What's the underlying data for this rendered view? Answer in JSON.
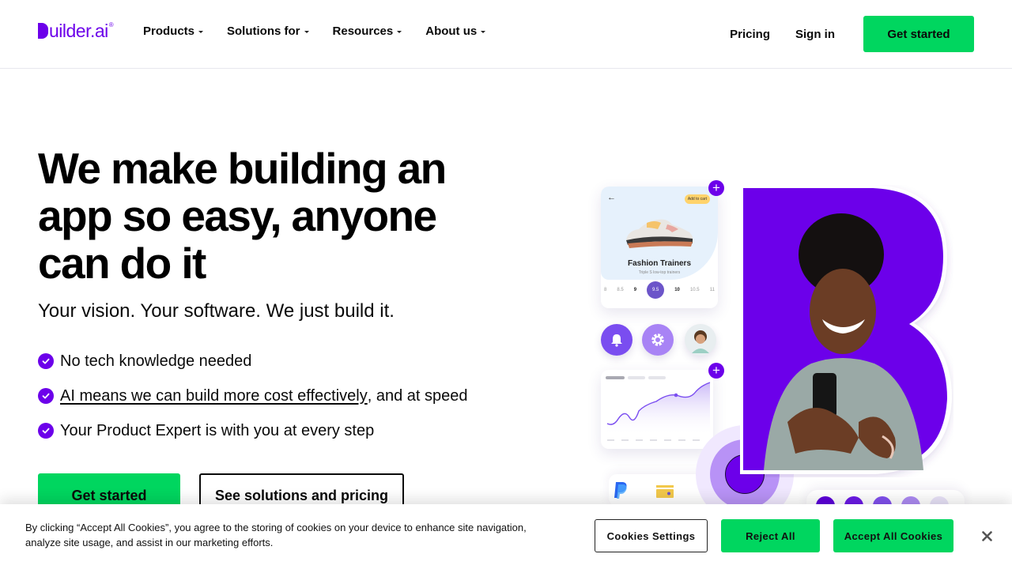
{
  "header": {
    "logo_text": "uilder.ai",
    "logo_reg": "®",
    "nav": [
      {
        "label": "Products"
      },
      {
        "label": "Solutions for"
      },
      {
        "label": "Resources"
      },
      {
        "label": "About us"
      }
    ],
    "pricing": "Pricing",
    "sign_in": "Sign in",
    "get_started": "Get started"
  },
  "hero": {
    "title": "We make building an app so easy, anyone can do it",
    "subtitle": "Your vision. Your software. We just build it.",
    "bullets": [
      {
        "text": "No tech knowledge needed"
      },
      {
        "link": "AI means we can build more cost effectively",
        "text": ", and at speed"
      },
      {
        "text": "Your Product Expert is with you at every step"
      }
    ],
    "cta_primary": "Get started",
    "cta_secondary": "See solutions and pricing"
  },
  "illustration": {
    "product_card": {
      "badge": "Add to cart",
      "title": "Fashion Trainers",
      "subtitle": "Triple S low-top trainers",
      "sizes": [
        "8",
        "8.5",
        "9",
        "9.5",
        "10",
        "10.5",
        "11"
      ],
      "selected_size": "9.5"
    },
    "colors": {
      "brand_purple": "#6c00ea",
      "cta_green": "#00d65f"
    }
  },
  "cookie": {
    "text": "By clicking “Accept All Cookies”, you agree to the storing of cookies on your device to enhance site navigation, analyze site usage, and assist in our marketing efforts.",
    "settings": "Cookies Settings",
    "reject": "Reject All",
    "accept": "Accept All Cookies"
  }
}
